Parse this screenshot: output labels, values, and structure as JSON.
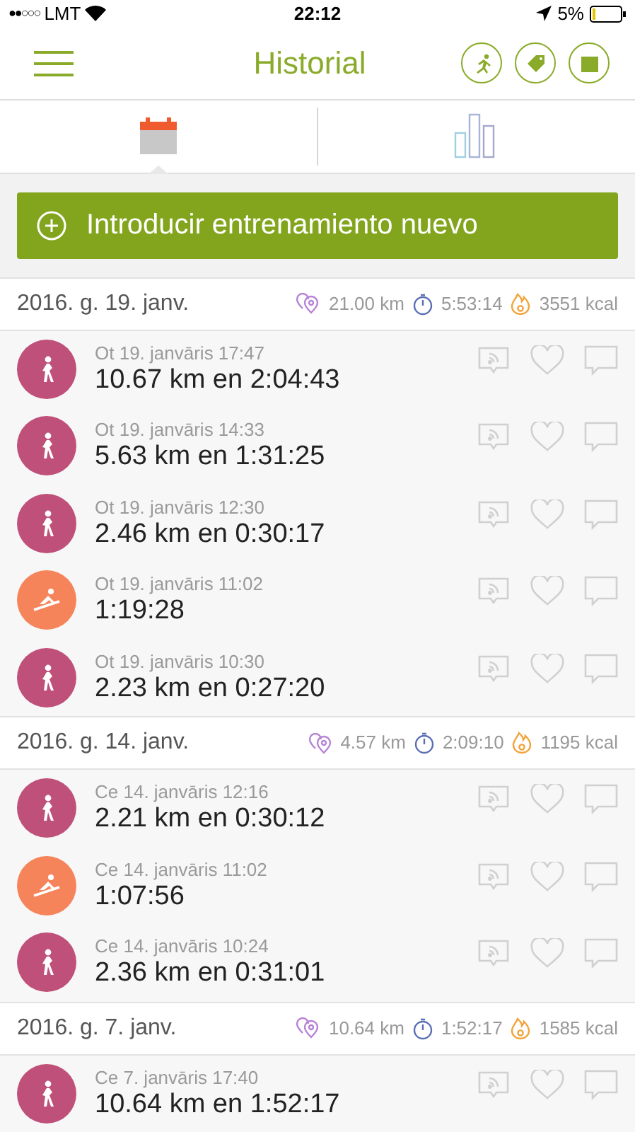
{
  "status_bar": {
    "signal": "●●○○○",
    "carrier": "LMT",
    "time": "22:12",
    "battery": "5%"
  },
  "nav": {
    "title": "Historial"
  },
  "tabs": [
    {
      "kind": "calendar",
      "selected": true
    },
    {
      "kind": "stats",
      "selected": false
    }
  ],
  "add_button": {
    "label": "Introducir entrenamiento nuevo"
  },
  "groups": [
    {
      "date": "2016. g. 19. janv.",
      "distance": "21.00 km",
      "duration": "5:53:14",
      "calories": "3551 kcal",
      "workouts": [
        {
          "kind": "walk",
          "time": "Ot 19. janvāris 17:47",
          "summary": "10.67 km en 2:04:43"
        },
        {
          "kind": "walk",
          "time": "Ot 19. janvāris 14:33",
          "summary": "5.63 km en 1:31:25"
        },
        {
          "kind": "walk",
          "time": "Ot 19. janvāris 12:30",
          "summary": "2.46 km en 0:30:17"
        },
        {
          "kind": "ski",
          "time": "Ot 19. janvāris 11:02",
          "summary": "1:19:28"
        },
        {
          "kind": "walk",
          "time": "Ot 19. janvāris 10:30",
          "summary": "2.23 km en 0:27:20"
        }
      ]
    },
    {
      "date": "2016. g. 14. janv.",
      "distance": "4.57 km",
      "duration": "2:09:10",
      "calories": "1195 kcal",
      "workouts": [
        {
          "kind": "walk",
          "time": "Ce 14. janvāris 12:16",
          "summary": "2.21 km en 0:30:12"
        },
        {
          "kind": "ski",
          "time": "Ce 14. janvāris 11:02",
          "summary": "1:07:56"
        },
        {
          "kind": "walk",
          "time": "Ce 14. janvāris 10:24",
          "summary": "2.36 km en 0:31:01"
        }
      ]
    },
    {
      "date": "2016. g. 7. janv.",
      "distance": "10.64 km",
      "duration": "1:52:17",
      "calories": "1585 kcal",
      "workouts": [
        {
          "kind": "walk",
          "time": "Ce 7. janvāris 17:40",
          "summary": "10.64 km en 1:52:17"
        }
      ]
    }
  ]
}
